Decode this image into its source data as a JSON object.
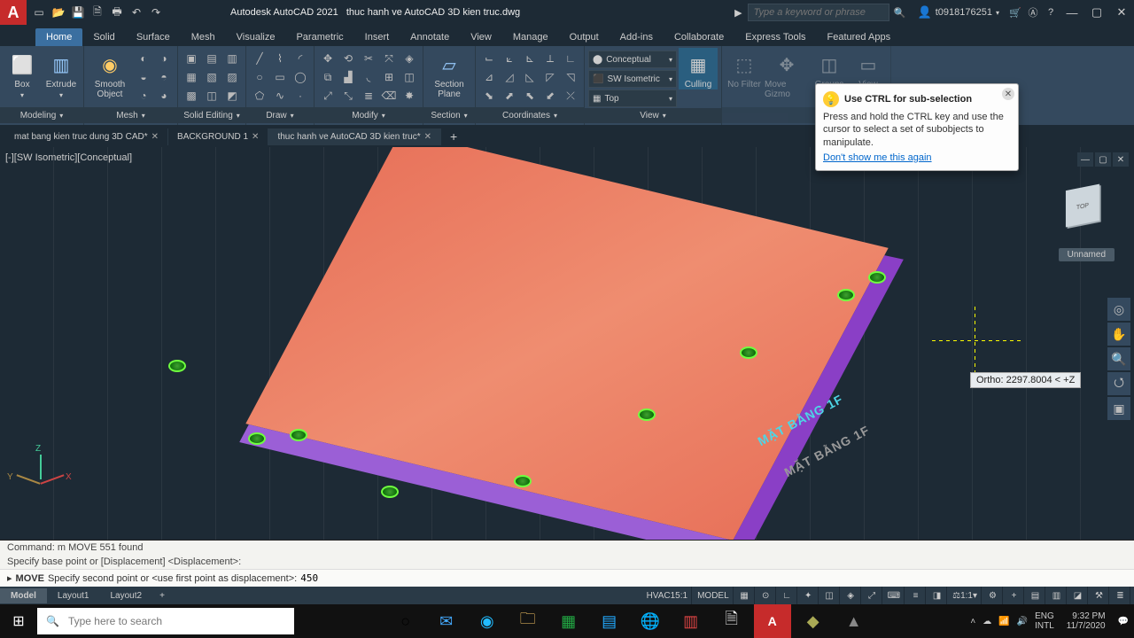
{
  "titlebar": {
    "app": "Autodesk AutoCAD 2021",
    "file": "thuc hanh ve AutoCAD 3D kien truc.dwg",
    "search_placeholder": "Type a keyword or phrase",
    "user": "t0918176251"
  },
  "menu": [
    "Home",
    "Solid",
    "Surface",
    "Mesh",
    "Visualize",
    "Parametric",
    "Insert",
    "Annotate",
    "View",
    "Manage",
    "Output",
    "Add-ins",
    "Collaborate",
    "Express Tools",
    "Featured Apps"
  ],
  "ribbon": {
    "panels": {
      "modeling": {
        "label": "Modeling",
        "box": "Box",
        "extrude": "Extrude",
        "smooth": "Smooth\nObject"
      },
      "mesh": {
        "label": "Mesh"
      },
      "solid_editing": {
        "label": "Solid Editing"
      },
      "draw": {
        "label": "Draw"
      },
      "modify": {
        "label": "Modify"
      },
      "section": {
        "label": "Section",
        "plane": "Section\nPlane"
      },
      "coordinates": {
        "label": "Coordinates"
      },
      "view": {
        "label": "View",
        "vstyle": "Conceptual",
        "vdir": "SW Isometric",
        "vtop": "Top",
        "culling": "Culling"
      },
      "selection_hint_panels": {
        "nofilter": "No Filter",
        "move_gizmo": "Move Gizmo",
        "groups": "Groups",
        "view_btn": "View"
      }
    }
  },
  "tooltip": {
    "title": "Use CTRL for sub-selection",
    "body": "Press and hold the CTRL key and use the cursor to select a set of subobjects to manipulate.",
    "link": "Don't show me this again"
  },
  "doctabs": [
    {
      "label": "mat bang kien truc dung 3D CAD*",
      "active": false
    },
    {
      "label": "BACKGROUND 1",
      "active": false
    },
    {
      "label": "thuc hanh ve AutoCAD 3D kien truc*",
      "active": true
    }
  ],
  "viewport": {
    "label": "[-][SW Isometric][Conceptual]",
    "annot1": "MẶT BẰNG 1F",
    "annot2": "MẶT BẰNG 1F",
    "unnamed": "Unnamed",
    "ortho": "Ortho: 2297.8004 < +Z",
    "ucs": {
      "x": "X",
      "y": "Y",
      "z": "Z"
    }
  },
  "command": {
    "history1": "Command: m MOVE 551 found",
    "history2": "Specify base point or [Displacement] <Displacement>:",
    "prompt_label": "MOVE",
    "prompt_text": "Specify second point or <use first point as displacement>:",
    "input": "450"
  },
  "layouts": [
    "Model",
    "Layout1",
    "Layout2"
  ],
  "status": {
    "left1": "HVAC15:1",
    "left2": "MODEL",
    "scale": "1:1"
  },
  "taskbar": {
    "search": "Type here to search",
    "lang1": "ENG",
    "lang2": "INTL",
    "time": "9:32 PM",
    "date": "11/7/2020"
  }
}
